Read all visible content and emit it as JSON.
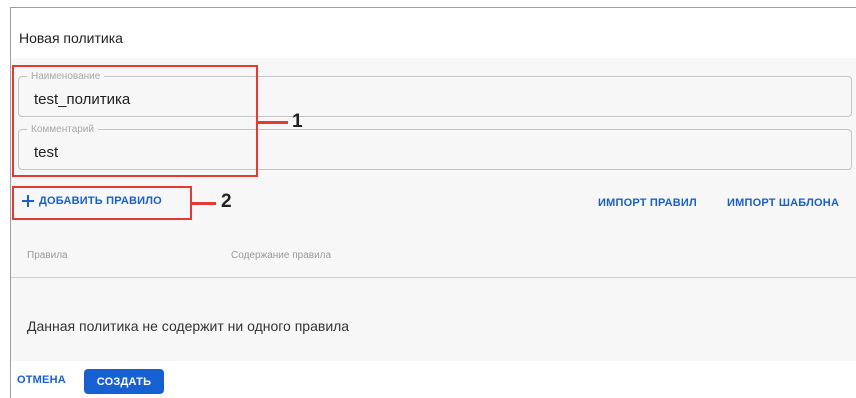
{
  "dialog": {
    "title": "Новая политика"
  },
  "form": {
    "name": {
      "label": "Наименование",
      "value": "test_политика"
    },
    "comment": {
      "label": "Комментарий",
      "value": "test"
    }
  },
  "toolbar": {
    "add_rule": "ДОБАВИТЬ ПРАВИЛО",
    "import_rules": "ИМПОРТ ПРАВИЛ",
    "import_template": "ИМПОРТ ШАБЛОНА"
  },
  "table": {
    "columns": [
      "Правила",
      "Содержание правила"
    ],
    "empty_message": "Данная политика не содержит ни одного правила"
  },
  "footer": {
    "cancel": "ОТМЕНА",
    "create": "СОЗДАТЬ"
  },
  "annotations": [
    {
      "number": "1"
    },
    {
      "number": "2"
    }
  ],
  "colors": {
    "accent": "#1660d4",
    "callout": "#e53935",
    "panel": "#f7f7f7"
  }
}
